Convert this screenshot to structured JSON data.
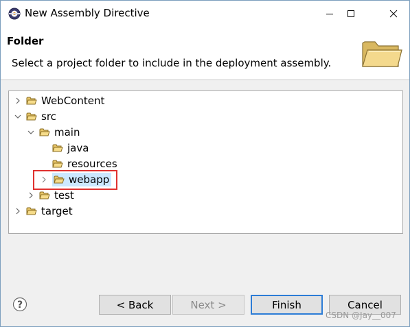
{
  "window": {
    "title": "New Assembly Directive"
  },
  "banner": {
    "title": "Folder",
    "description": "Select a project folder to include in the deployment assembly."
  },
  "tree": {
    "items": [
      {
        "label": "WebContent",
        "expanded": false
      },
      {
        "label": "src",
        "expanded": true
      },
      {
        "label": "main",
        "expanded": true
      },
      {
        "label": "java"
      },
      {
        "label": "resources"
      },
      {
        "label": "webapp",
        "expanded": false,
        "selected": true
      },
      {
        "label": "test",
        "expanded": false
      },
      {
        "label": "target",
        "expanded": false
      }
    ]
  },
  "buttons": {
    "back": "< Back",
    "next": "Next >",
    "finish": "Finish",
    "cancel": "Cancel"
  },
  "watermark": "CSDN @Jay__007",
  "colors": {
    "selection": "#cce8ff",
    "highlight_box": "#e0312f",
    "default_button_border": "#2c7cd6",
    "folder_fill": "#f4d27a"
  }
}
